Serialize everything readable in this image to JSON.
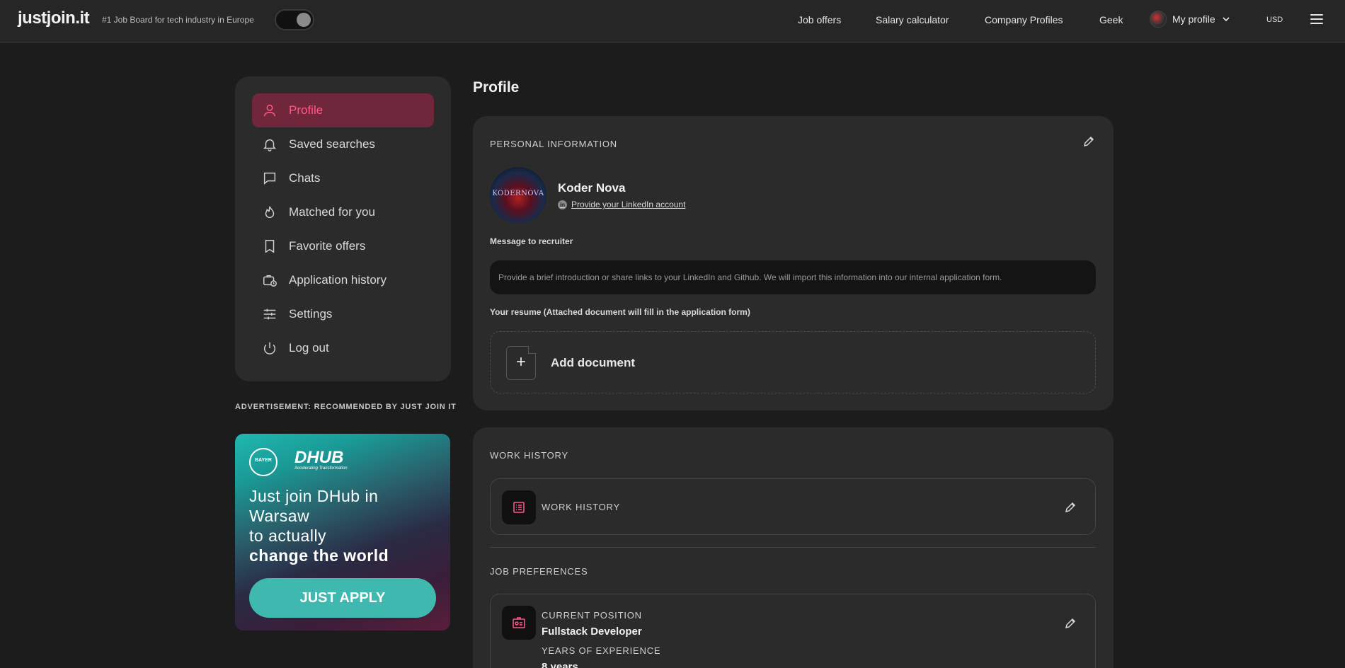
{
  "header": {
    "logo": "justjoin.it",
    "tagline": "#1 Job Board for tech industry in Europe",
    "nav": [
      "Job offers",
      "Salary calculator",
      "Company Profiles",
      "Geek"
    ],
    "profile_label": "My profile",
    "currency": "USD"
  },
  "sidebar": {
    "items": [
      {
        "label": "Profile",
        "icon": "user-icon",
        "active": true
      },
      {
        "label": "Saved searches",
        "icon": "bell-icon"
      },
      {
        "label": "Chats",
        "icon": "chat-icon"
      },
      {
        "label": "Matched for you",
        "icon": "flame-icon"
      },
      {
        "label": "Favorite offers",
        "icon": "bookmark-icon"
      },
      {
        "label": "Application history",
        "icon": "briefcase-clock-icon"
      },
      {
        "label": "Settings",
        "icon": "sliders-icon"
      },
      {
        "label": "Log out",
        "icon": "power-icon"
      }
    ]
  },
  "ad": {
    "label": "ADVERTISEMENT: RECOMMENDED BY JUST JOIN IT",
    "bayer": "BAYER",
    "dhub": "DHUB",
    "dhub_sub": "Accelerating Transformation",
    "line1": "Just join DHub in",
    "line2": "Warsaw",
    "line3": "to actually",
    "line4": "change the world",
    "cta": "JUST APPLY"
  },
  "main": {
    "title": "Profile",
    "personal": {
      "section": "PERSONAL INFORMATION",
      "name": "Koder Nova",
      "avatar_text": "KODERNOVA",
      "linkedin": "Provide your LinkedIn account",
      "message_label": "Message to recruiter",
      "message_placeholder": "Provide a brief introduction or share links to your LinkedIn and Github. We will import this information into our internal application form.",
      "resume_label": "Your resume (Attached document will fill in the application form)",
      "add_document": "Add document"
    },
    "work": {
      "section": "WORK HISTORY",
      "item_label": "WORK HISTORY"
    },
    "prefs": {
      "section": "JOB PREFERENCES",
      "current_position_label": "CURRENT POSITION",
      "current_position": "Fullstack Developer",
      "years_label": "YEARS OF EXPERIENCE",
      "years": "8 years"
    }
  },
  "colors": {
    "accent": "#ff5a8a",
    "active_bg": "#70263b",
    "page_bg": "#1c1c1c",
    "card_bg": "#2b2b2b"
  }
}
